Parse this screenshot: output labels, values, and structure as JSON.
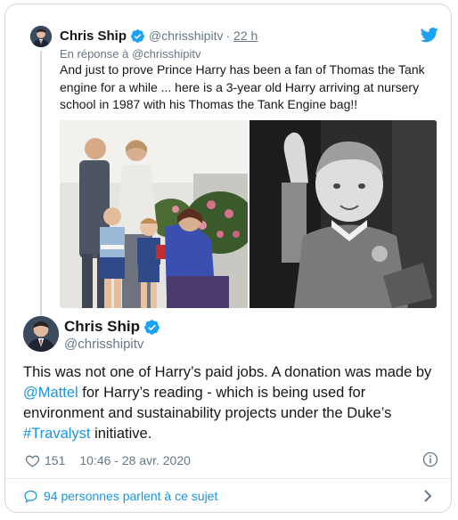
{
  "parent_tweet": {
    "author_name": "Chris Ship",
    "handle": "@chrisshipitv",
    "separator": "·",
    "time": "22 h",
    "reply_context": "En réponse à @chrisshipitv",
    "text": "And just to prove Prince Harry has been a fan of Thomas the Tank engine for a while ... here is a 3-year old Harry arriving at nursery school in 1987 with his Thomas the Tank Engine bag!!",
    "photos": [
      "photo-family-nursery",
      "photo-harry-waving"
    ]
  },
  "main_tweet": {
    "author_name": "Chris Ship",
    "handle": "@chrisshipitv",
    "text_part1": "This was not one of Harry’s paid jobs. A donation was made by ",
    "mention": "@Mattel",
    "text_part2": " for Harry’s reading - which is being used for environment and sustainability projects under the Duke’s ",
    "hashtag": "#Travalyst",
    "text_part3": " initiative.",
    "likes": "151",
    "timestamp": "10:46 - 28 avr. 2020"
  },
  "footer": {
    "conversation": "94 personnes parlent à ce sujet"
  },
  "colors": {
    "accent": "#1b95e0",
    "muted": "#657786",
    "text": "#14171a",
    "border": "#cfd9de"
  },
  "icons": [
    "verified-badge-icon",
    "twitter-bird-icon",
    "heart-icon",
    "info-icon",
    "speech-bubble-icon",
    "chevron-right-icon"
  ]
}
